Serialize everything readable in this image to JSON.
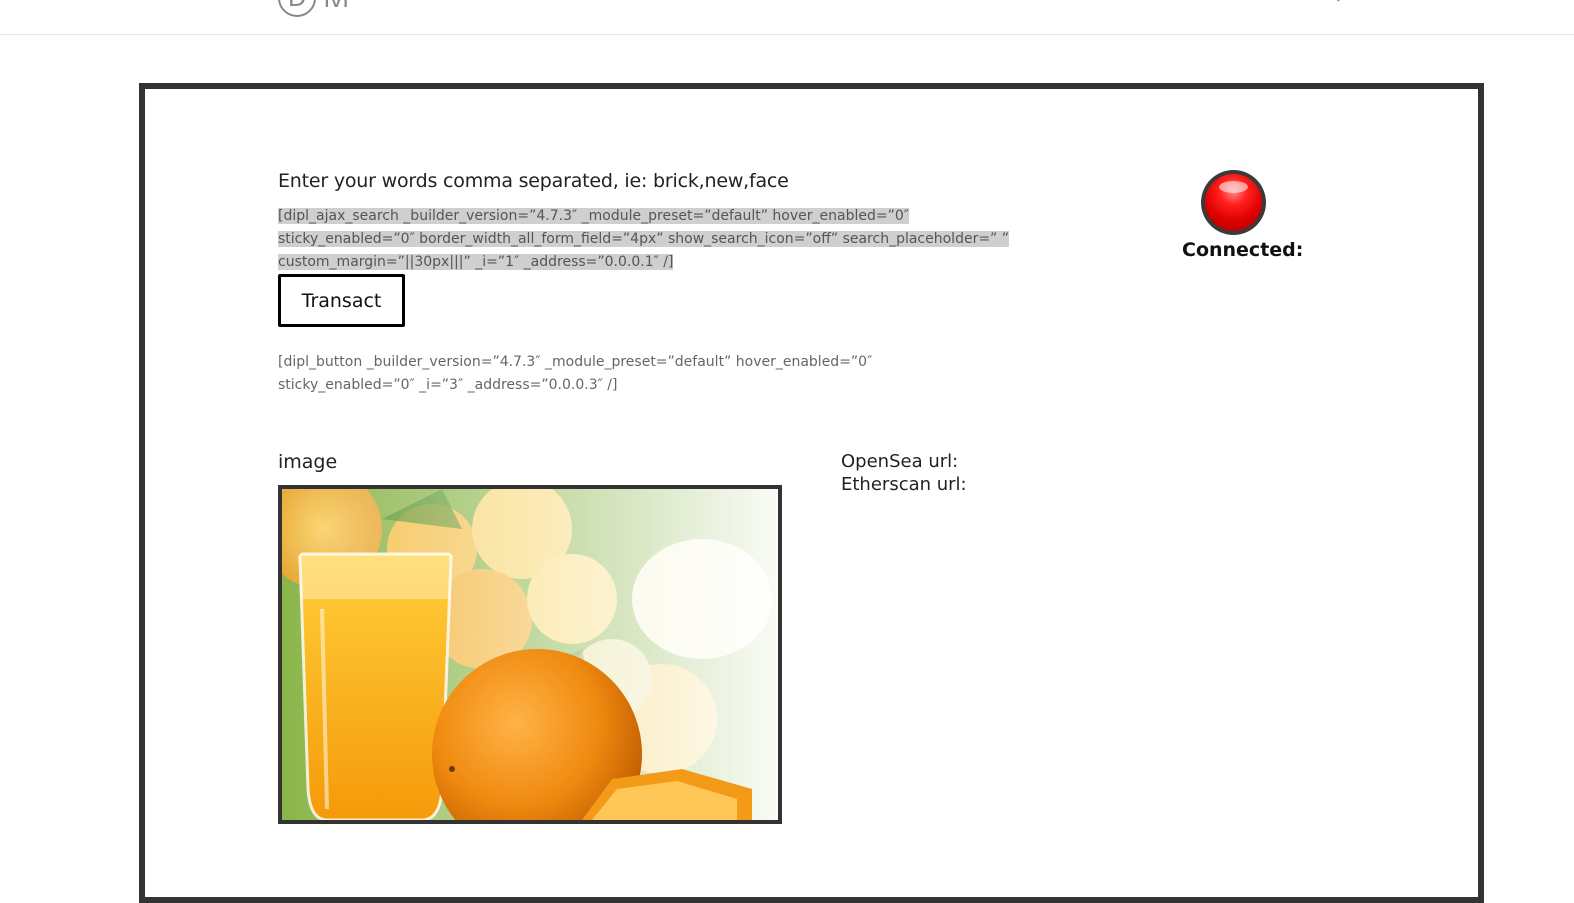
{
  "header": {
    "logo_letter": "D",
    "logo_text": "ivi"
  },
  "main": {
    "instruction": "Enter your words comma separated, ie: brick,new,face",
    "search_shortcode": "[dipl_ajax_search _builder_version=”4.7.3″ _module_preset=”default” hover_enabled=”0″ sticky_enabled=”0″ border_width_all_form_field=”4px” show_search_icon=”off” search_placeholder=” ” custom_margin=”||30px|||” _i=”1″ _address=”0.0.0.1″ /]",
    "transact_label": "Transact",
    "button_shortcode": "[dipl_button _builder_version=”4.7.3″ _module_preset=”default” hover_enabled=”0″ sticky_enabled=”0″ _i=”3″ _address=”0.0.0.3″ /]",
    "status_label": "Connected:",
    "status_color": "#e00000",
    "image_label": "image",
    "opensea_label": "OpenSea url:",
    "etherscan_label": "Etherscan url:"
  }
}
